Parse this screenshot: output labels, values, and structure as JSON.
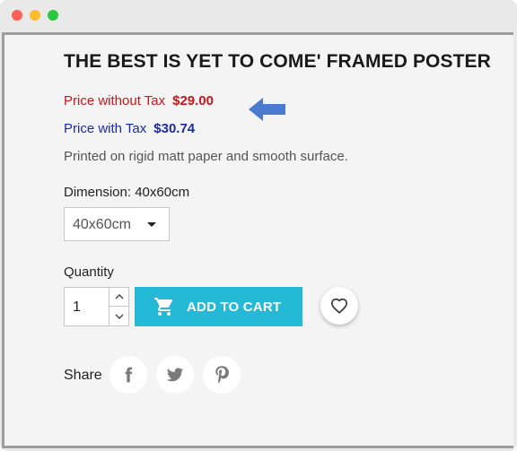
{
  "window": {
    "controls": [
      "close",
      "minimize",
      "zoom"
    ]
  },
  "product": {
    "title": "THE BEST IS YET TO COME' FRAMED POSTER",
    "price_without_tax_label": "Price without Tax",
    "price_without_tax_value": "$29.00",
    "price_with_tax_label": "Price with Tax",
    "price_with_tax_value": "$30.74",
    "description": "Printed on rigid matt paper and smooth surface."
  },
  "dimension": {
    "label": "Dimension: 40x60cm",
    "selected": "40x60cm"
  },
  "quantity": {
    "label": "Quantity",
    "value": "1"
  },
  "cart": {
    "add_label": "ADD TO CART"
  },
  "share": {
    "label": "Share",
    "networks": [
      "facebook",
      "twitter",
      "pinterest"
    ]
  },
  "colors": {
    "price_without_tax": "#c8161c",
    "price_with_tax": "#1a2bb0",
    "add_to_cart_bg": "#24b9d7",
    "annotation_arrow": "#4a7bd0"
  }
}
